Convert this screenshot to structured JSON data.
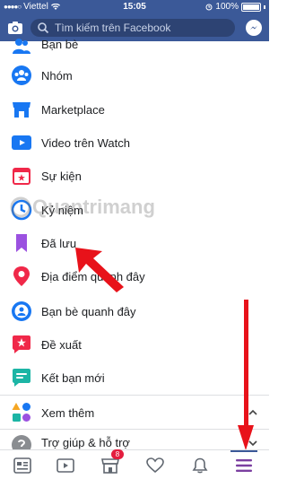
{
  "status_bar": {
    "carrier": "Viettel",
    "time": "15:05",
    "battery": "100%"
  },
  "header": {
    "search_placeholder": "Tìm kiếm trên Facebook"
  },
  "menu_items": [
    {
      "label": "Bạn bè",
      "icon": "friends-icon"
    },
    {
      "label": "Nhóm",
      "icon": "groups-icon"
    },
    {
      "label": "Marketplace",
      "icon": "marketplace-icon"
    },
    {
      "label": "Video trên Watch",
      "icon": "watch-icon"
    },
    {
      "label": "Sự kiện",
      "icon": "events-icon"
    },
    {
      "label": "Kỷ niệm",
      "icon": "memories-icon"
    },
    {
      "label": "Đã lưu",
      "icon": "saved-icon"
    },
    {
      "label": "Địa điểm quanh đây",
      "icon": "places-icon"
    },
    {
      "label": "Bạn bè quanh đây",
      "icon": "nearby-friends-icon"
    },
    {
      "label": "Đề xuất",
      "icon": "recommendations-icon"
    },
    {
      "label": "Kết bạn mới",
      "icon": "find-friends-icon"
    },
    {
      "label": "Xem thêm",
      "icon": "see-more-icon"
    },
    {
      "label": "Trợ giúp & hỗ trợ",
      "icon": "help-icon"
    }
  ],
  "watermark": {
    "text": "Quantrimang"
  },
  "tab_bar": {
    "tabs": [
      {
        "name": "news-feed-tab"
      },
      {
        "name": "watch-tab"
      },
      {
        "name": "marketplace-tab",
        "badge": "8"
      },
      {
        "name": "dating-tab"
      },
      {
        "name": "notifications-tab"
      },
      {
        "name": "menu-tab"
      }
    ]
  },
  "colors": {
    "brand": "#3b5998",
    "arrow": "#e8121a",
    "badge": "#e41e3f"
  }
}
